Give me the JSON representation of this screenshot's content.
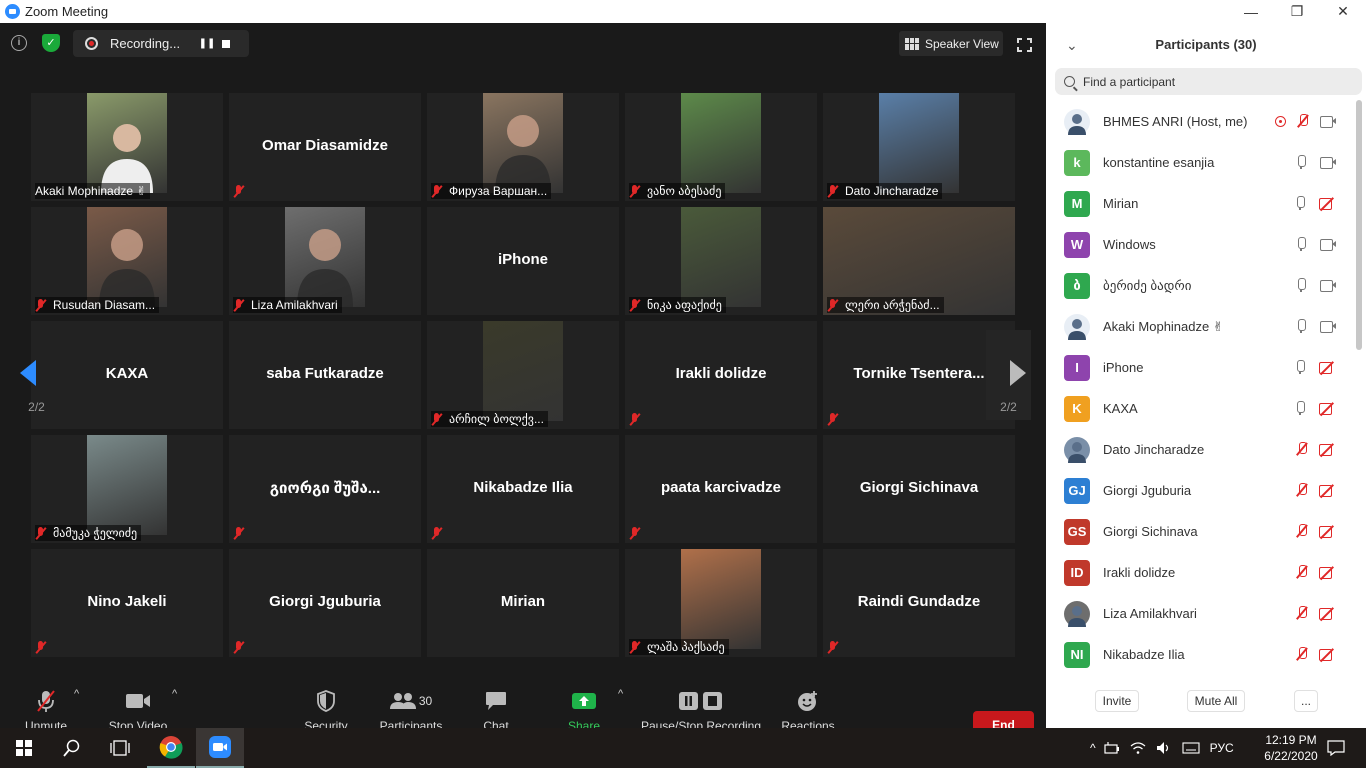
{
  "window": {
    "title": "Zoom Meeting",
    "buttons": [
      "—",
      "❐",
      "✕"
    ]
  },
  "topbar": {
    "recording_label": "Recording...",
    "pause_symbol": "❚❚",
    "speaker_view_label": "Speaker View"
  },
  "tiles": [
    {
      "name": "Akaki Mophinadze ✌",
      "video": true,
      "muted": false,
      "bg": "#8a9a6a"
    },
    {
      "name": "Omar Diasamidze",
      "video": false,
      "muted": true
    },
    {
      "name": "Фируза Варшан...",
      "video": true,
      "muted": true,
      "bg": "#8a7560"
    },
    {
      "name": "ვანო აბესაძე",
      "video": true,
      "muted": true,
      "bg": "#5d8a4a"
    },
    {
      "name": "Dato Jincharadze",
      "video": true,
      "muted": true,
      "bg": "#5a7fa8"
    },
    {
      "name": "Rusudan Diasam...",
      "video": true,
      "muted": true,
      "bg": "#7a5a48"
    },
    {
      "name": "Liza Amilakhvari",
      "video": true,
      "muted": true,
      "bg": "#6e6e6e"
    },
    {
      "name": "iPhone",
      "video": false,
      "muted": false
    },
    {
      "name": "ნიკა აფაქიძე",
      "video": true,
      "muted": true,
      "bg": "#4a5a3a"
    },
    {
      "name": "ლერი არჭენაძ...",
      "video": true,
      "muted": true,
      "bg": "#5a4a3a",
      "full": true
    },
    {
      "name": "KAXA",
      "video": false,
      "muted": false
    },
    {
      "name": "saba Futkaradze",
      "video": false,
      "muted": false
    },
    {
      "name": "არჩილ ბოლქვ...",
      "video": true,
      "muted": true,
      "bg": "#3a3a2a"
    },
    {
      "name": "Irakli dolidze",
      "video": false,
      "muted": true
    },
    {
      "name": "Tornike  Tsentera...",
      "video": false,
      "muted": true
    },
    {
      "name": "მამუკა ჭელიძე",
      "video": true,
      "muted": true,
      "bg": "#7a8a8a"
    },
    {
      "name": "გიორგი  შუშა...",
      "video": false,
      "muted": true
    },
    {
      "name": "Nikabadze Ilia",
      "video": false,
      "muted": true
    },
    {
      "name": "paata karcivadze",
      "video": false,
      "muted": true
    },
    {
      "name": "Giorgi Sichinava",
      "video": false,
      "muted": false
    },
    {
      "name": "Nino Jakeli",
      "video": false,
      "muted": true
    },
    {
      "name": "Giorgi Jguburia",
      "video": false,
      "muted": true
    },
    {
      "name": "Mirian",
      "video": false,
      "muted": false
    },
    {
      "name": "ლაშა პაქსაძე",
      "video": true,
      "muted": true,
      "bg": "#b0704a"
    },
    {
      "name": "Raindi Gundadze",
      "video": false,
      "muted": true
    }
  ],
  "pagination": {
    "left_label": "2/2",
    "right_label": "2/2"
  },
  "toolbar": {
    "unmute": "Unmute",
    "stop_video": "Stop Video",
    "security": "Security",
    "participants": "Participants",
    "participants_count": "30",
    "chat": "Chat",
    "share_screen": "Share Screen",
    "pause_stop_recording": "Pause/Stop Recording",
    "reactions": "Reactions",
    "end": "End"
  },
  "panel": {
    "title": "Participants (30)",
    "search_placeholder": "Find a participant",
    "participants": [
      {
        "name": "BHMES ANRI (Host, me)",
        "initials": "",
        "color": "#e8eef5",
        "photo": true,
        "mic": "muted",
        "cam": "on",
        "rec": true
      },
      {
        "name": "konstantine esanjia",
        "initials": "k",
        "color": "#5cb85c",
        "mic": "on",
        "cam": "on"
      },
      {
        "name": "Mirian",
        "initials": "M",
        "color": "#2fa84f",
        "mic": "on",
        "cam": "off"
      },
      {
        "name": "Windows",
        "initials": "W",
        "color": "#8e44ad",
        "mic": "on",
        "cam": "on"
      },
      {
        "name": "ბერიძე ბადრი",
        "initials": "ბ",
        "color": "#2fa84f",
        "mic": "on",
        "cam": "on"
      },
      {
        "name": "Akaki Mophinadze ✌",
        "initials": "",
        "color": "#e8eef5",
        "photo": true,
        "mic": "on",
        "cam": "on"
      },
      {
        "name": "iPhone",
        "initials": "I",
        "color": "#8e44ad",
        "mic": "on",
        "cam": "off"
      },
      {
        "name": "KAXA",
        "initials": "K",
        "color": "#f0a020",
        "mic": "on",
        "cam": "off"
      },
      {
        "name": "Dato Jincharadze",
        "initials": "",
        "color": "#7a8fa8",
        "photo": true,
        "mic": "muted",
        "cam": "off"
      },
      {
        "name": "Giorgi Jguburia",
        "initials": "GJ",
        "color": "#2d7fd3",
        "mic": "muted",
        "cam": "off"
      },
      {
        "name": "Giorgi Sichinava",
        "initials": "GS",
        "color": "#c0392b",
        "mic": "muted",
        "cam": "off"
      },
      {
        "name": "Irakli dolidze",
        "initials": "ID",
        "color": "#c0392b",
        "mic": "muted",
        "cam": "off"
      },
      {
        "name": "Liza Amilakhvari",
        "initials": "",
        "color": "#6e6e6e",
        "photo": true,
        "mic": "muted",
        "cam": "off"
      },
      {
        "name": "Nikabadze Ilia",
        "initials": "NI",
        "color": "#2fa84f",
        "mic": "muted",
        "cam": "off"
      }
    ],
    "invite": "Invite",
    "mute_all": "Mute All",
    "more": "..."
  },
  "taskbar": {
    "lang": "РУС",
    "time": "12:19 PM",
    "date": "6/22/2020"
  }
}
